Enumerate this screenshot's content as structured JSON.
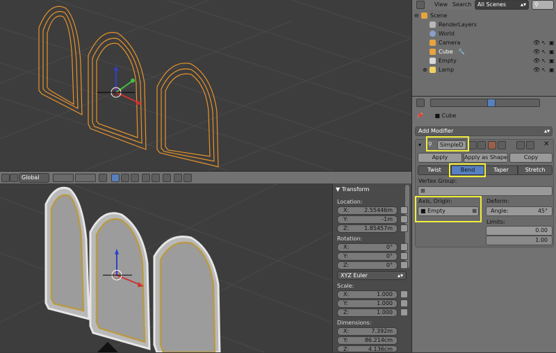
{
  "header": {
    "orientation": "Global"
  },
  "outliner": {
    "menu": [
      "View",
      "Search"
    ],
    "scene_filter": "All Scenes",
    "items": [
      {
        "label": "Scene",
        "icon": "scene-icon"
      },
      {
        "label": "RenderLayers",
        "icon": "render-layers-icon"
      },
      {
        "label": "World",
        "icon": "world-icon"
      },
      {
        "label": "Camera",
        "icon": "camera-icon"
      },
      {
        "label": "Cube",
        "icon": "mesh-icon"
      },
      {
        "label": "Empty",
        "icon": "empty-icon"
      },
      {
        "label": "Lamp",
        "icon": "lamp-icon"
      }
    ]
  },
  "properties": {
    "context_object": "Cube",
    "add_modifier": "Add Modifier",
    "modifier_name": "SimpleD",
    "apply": "Apply",
    "apply_as_shape": "Apply as Shape ...",
    "copy": "Copy",
    "modes": [
      "Twist",
      "Bend",
      "Taper",
      "Stretch"
    ],
    "active_mode": "Bend",
    "vertex_group_label": "Vertex Group:",
    "axis_origin_label": "Axis, Origin:",
    "axis_origin_value": "Empty",
    "deform_label": "Deform:",
    "angle_label": "Angle:",
    "angle_value": "45°",
    "limits_label": "Limits:",
    "limit_min": "0.00",
    "limit_max": "1.00",
    "highlight_color": "#f2ef3d"
  },
  "transform": {
    "title": "Transform",
    "location_label": "Location:",
    "location": [
      {
        "axis": "X:",
        "value": "2.55446m"
      },
      {
        "axis": "Y:",
        "value": "-1m"
      },
      {
        "axis": "Z:",
        "value": "1.85457m"
      }
    ],
    "rotation_label": "Rotation:",
    "rotation": [
      {
        "axis": "X:",
        "value": "0°"
      },
      {
        "axis": "Y:",
        "value": "0°"
      },
      {
        "axis": "Z:",
        "value": "0°"
      }
    ],
    "rotation_mode": "XYZ Euler",
    "scale_label": "Scale:",
    "scale": [
      {
        "axis": "X:",
        "value": "1.000"
      },
      {
        "axis": "Y:",
        "value": "1.000"
      },
      {
        "axis": "Z:",
        "value": "1.000"
      }
    ],
    "dimensions_label": "Dimensions:",
    "dimensions": [
      {
        "axis": "X:",
        "value": "7.392m"
      },
      {
        "axis": "Y:",
        "value": "86.214cm"
      },
      {
        "axis": "Z:",
        "value": "4.136cm"
      }
    ]
  }
}
